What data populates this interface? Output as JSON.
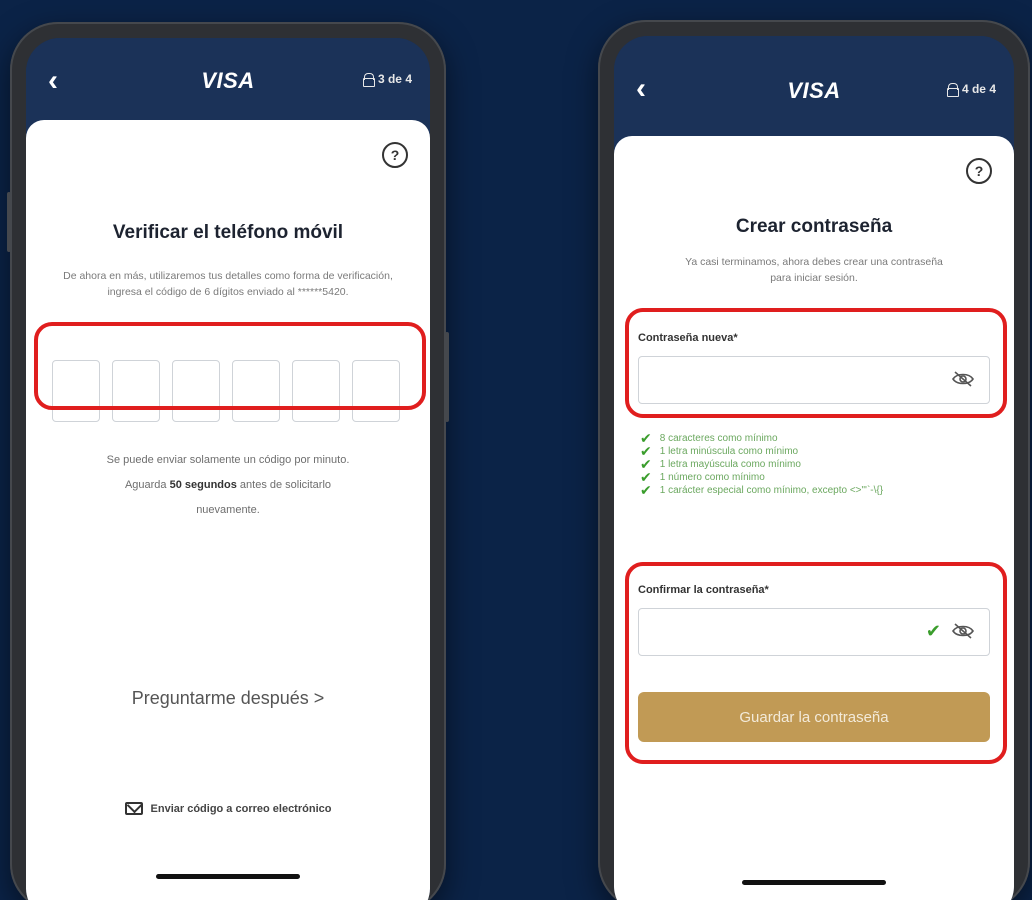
{
  "colors": {
    "background": "#0b2347",
    "appbar": "#1b3258",
    "highlight": "#e01e1e",
    "accent_gold": "#c19a55",
    "success": "#3a9d2c"
  },
  "left_phone": {
    "brand": "VISA",
    "step": "3 de 4",
    "title": "Verificar el teléfono móvil",
    "description": "De ahora en más, utilizaremos tus detalles como forma de verificación, ingresa el código de 6 dígitos enviado al ******5420.",
    "otp_digits": [
      "",
      "",
      "",
      "",
      "",
      ""
    ],
    "note_before": "Se puede enviar solamente un código por minuto. Aguarda",
    "note_bold": "50 segundos",
    "note_after": "antes de solicitarlo nuevamente.",
    "ask_later": "Preguntarme después >",
    "email_link": "Enviar código a correo electrónico"
  },
  "right_phone": {
    "brand": "VISA",
    "step": "4 de 4",
    "title": "Crear contraseña",
    "description": "Ya casi terminamos, ahora debes crear una contraseña para iniciar sesión.",
    "new_password_label": "Contraseña nueva*",
    "new_password_value": "",
    "rules": [
      "8 caracteres como mínimo",
      "1 letra minúscula como mínimo",
      "1 letra mayúscula como mínimo",
      "1 número como mínimo",
      "1 carácter especial como mínimo, excepto <>\"'`-\\{}"
    ],
    "confirm_password_label": "Confirmar la contraseña*",
    "confirm_password_value": "",
    "save_button": "Guardar la contraseña"
  },
  "icons": [
    "back-arrow-icon",
    "lock-icon",
    "help-icon",
    "mail-icon",
    "eye-slash-icon",
    "checkmark-icon"
  ]
}
